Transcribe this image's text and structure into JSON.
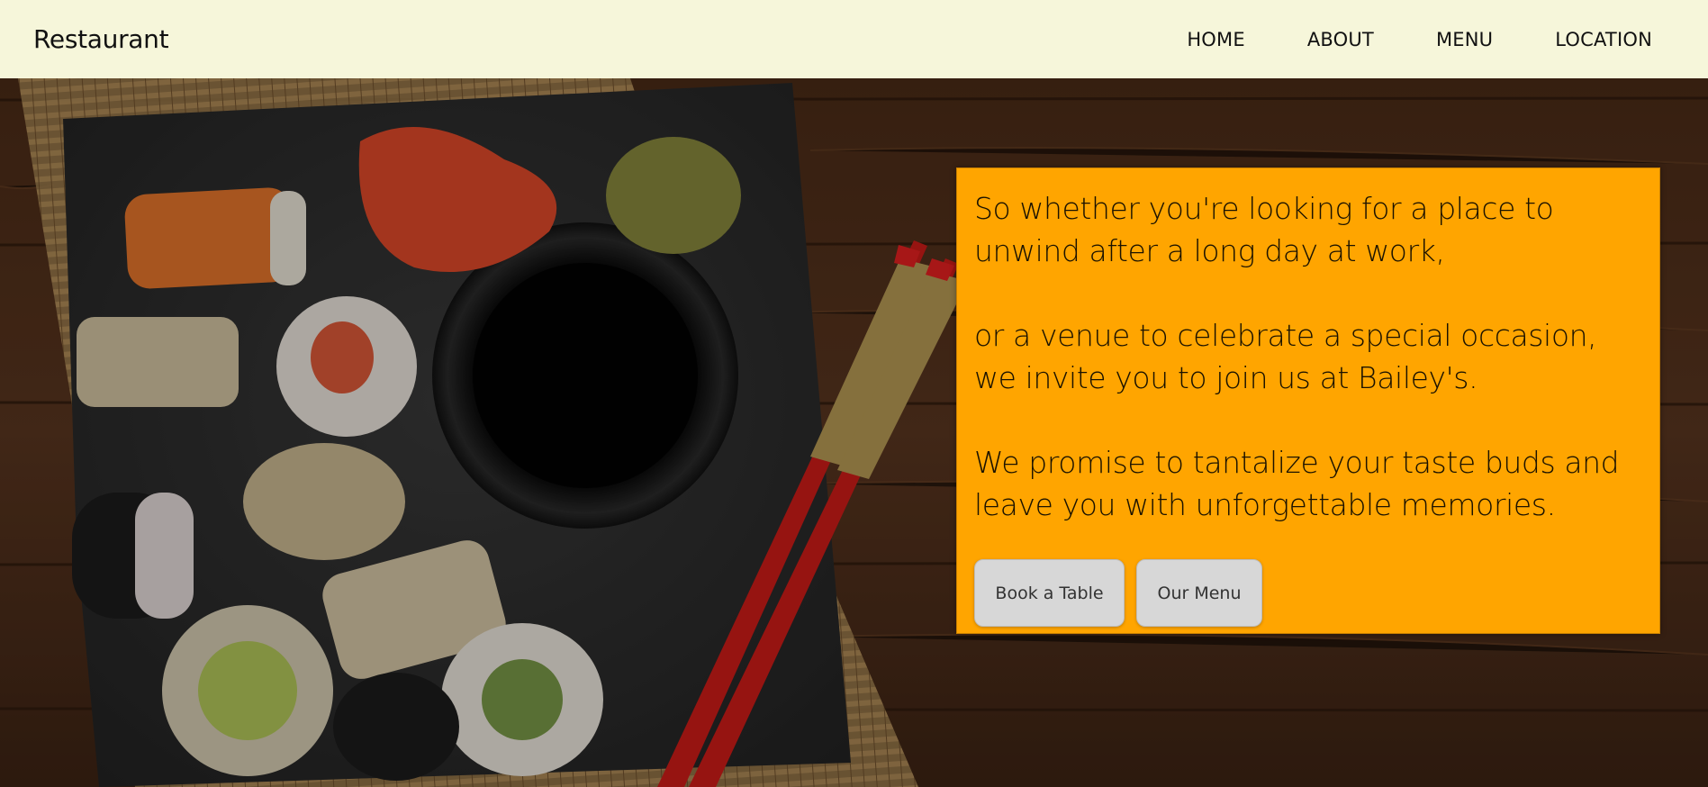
{
  "navbar": {
    "brand": "Restaurant",
    "links": [
      "HOME",
      "ABOUT",
      "MENU",
      "LOCATION"
    ]
  },
  "hero": {
    "paragraphs": [
      [
        "So whether you're looking for a place to",
        "unwind after a long day at work,"
      ],
      [
        "or a venue to celebrate a special occasion,",
        "we invite you to join us at Bailey's."
      ],
      [
        "We promise to tantalize your taste buds and",
        "leave you with unforgettable memories."
      ]
    ],
    "buttons": {
      "book": "Book a Table",
      "menu": "Our Menu"
    }
  },
  "colors": {
    "navbar_bg": "#f6f6da",
    "promo_bg": "#ffa500",
    "button_bg": "#d7d7d7",
    "wood": "#4a2c18"
  },
  "background_image": "sushi-platter-photo"
}
